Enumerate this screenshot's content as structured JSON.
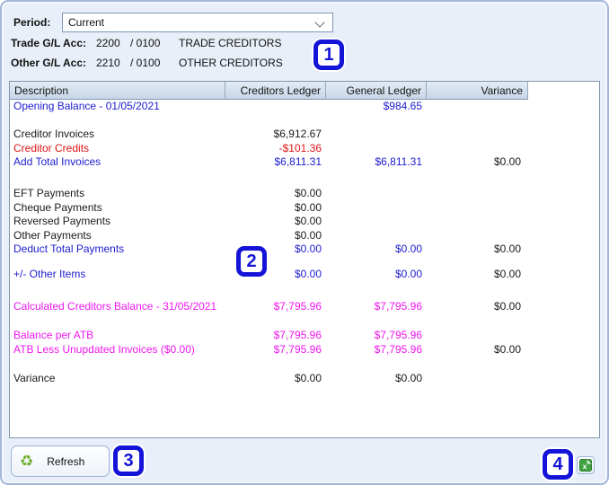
{
  "period": {
    "label": "Period:",
    "value": "Current"
  },
  "accounts": {
    "trade": {
      "label": "Trade G/L Acc:",
      "code": "2200",
      "sub": "/ 0100",
      "name": "TRADE CREDITORS"
    },
    "other": {
      "label": "Other G/L Acc:",
      "code": "2210",
      "sub": "/ 0100",
      "name": "OTHER CREDITORS"
    }
  },
  "table": {
    "headers": [
      "Description",
      "Creditors Ledger",
      "General Ledger",
      "Variance"
    ],
    "rows": [
      {
        "label": "Opening Balance - 01/05/2021",
        "color": "blue",
        "cl": "",
        "gl": "$984.65",
        "var": ""
      },
      {
        "spacer": true,
        "h": 15.5
      },
      {
        "label": "Creditor Invoices",
        "color": "black",
        "cl": "$6,912.67",
        "gl": "",
        "var": ""
      },
      {
        "label": "Creditor Credits",
        "color": "red",
        "cl": "-$101.36",
        "gl": "",
        "var": ""
      },
      {
        "label": "Add Total Invoices",
        "color": "blue",
        "cl": "$6,811.31",
        "gl": "$6,811.31",
        "var": "$0.00"
      },
      {
        "spacer": true,
        "h": 19.5
      },
      {
        "label": "EFT Payments",
        "color": "black",
        "cl": "$0.00",
        "gl": "",
        "var": ""
      },
      {
        "label": "Cheque Payments",
        "color": "black",
        "cl": "$0.00",
        "gl": "",
        "var": ""
      },
      {
        "label": "Reversed Payments",
        "color": "black",
        "cl": "$0.00",
        "gl": "",
        "var": ""
      },
      {
        "label": "Other Payments",
        "color": "black",
        "cl": "$0.00",
        "gl": "",
        "var": ""
      },
      {
        "label": "Deduct Total Payments",
        "color": "blue",
        "cl": "$0.00",
        "gl": "$0.00",
        "var": "$0.00"
      },
      {
        "spacer": true,
        "h": 12.5
      },
      {
        "label": "+/- Other Items",
        "color": "blue",
        "cl": "$0.00",
        "gl": "$0.00",
        "var": "$0.00"
      },
      {
        "spacer": true,
        "h": 20.5
      },
      {
        "label": "Calculated Creditors Balance - 31/05/2021",
        "color": "magenta",
        "cl": "$7,795.96",
        "gl": "$7,795.96",
        "var": "$0.00"
      },
      {
        "spacer": true,
        "h": 16.5
      },
      {
        "label": "Balance per ATB",
        "color": "magenta",
        "cl": "$7,795.96",
        "gl": "$7,795.96",
        "var": ""
      },
      {
        "label": "ATB Less Unupdated Invoices ($0.00)",
        "color": "magenta",
        "cl": "$7,795.96",
        "gl": "$7,795.96",
        "var": "$0.00"
      },
      {
        "spacer": true,
        "h": 17
      },
      {
        "label": "Variance",
        "color": "black",
        "cl": "$0.00",
        "gl": "$0.00",
        "var": ""
      }
    ]
  },
  "footer": {
    "refresh_label": "Refresh",
    "recycle_glyph": "♻"
  },
  "annotations": [
    {
      "label": "1"
    },
    {
      "label": "2"
    },
    {
      "label": "3"
    },
    {
      "label": "4"
    }
  ],
  "colors": {
    "text_blue": "#1c1ccf",
    "text_red": "#dd1515",
    "text_magenta": "#ee16ee",
    "annotation_blue": "#1414d8",
    "recycle_green": "#6fae2a",
    "excel_green": "#3fa33f",
    "header_fill": "#c7d6e7",
    "panel_bg": "#e9eff9"
  }
}
